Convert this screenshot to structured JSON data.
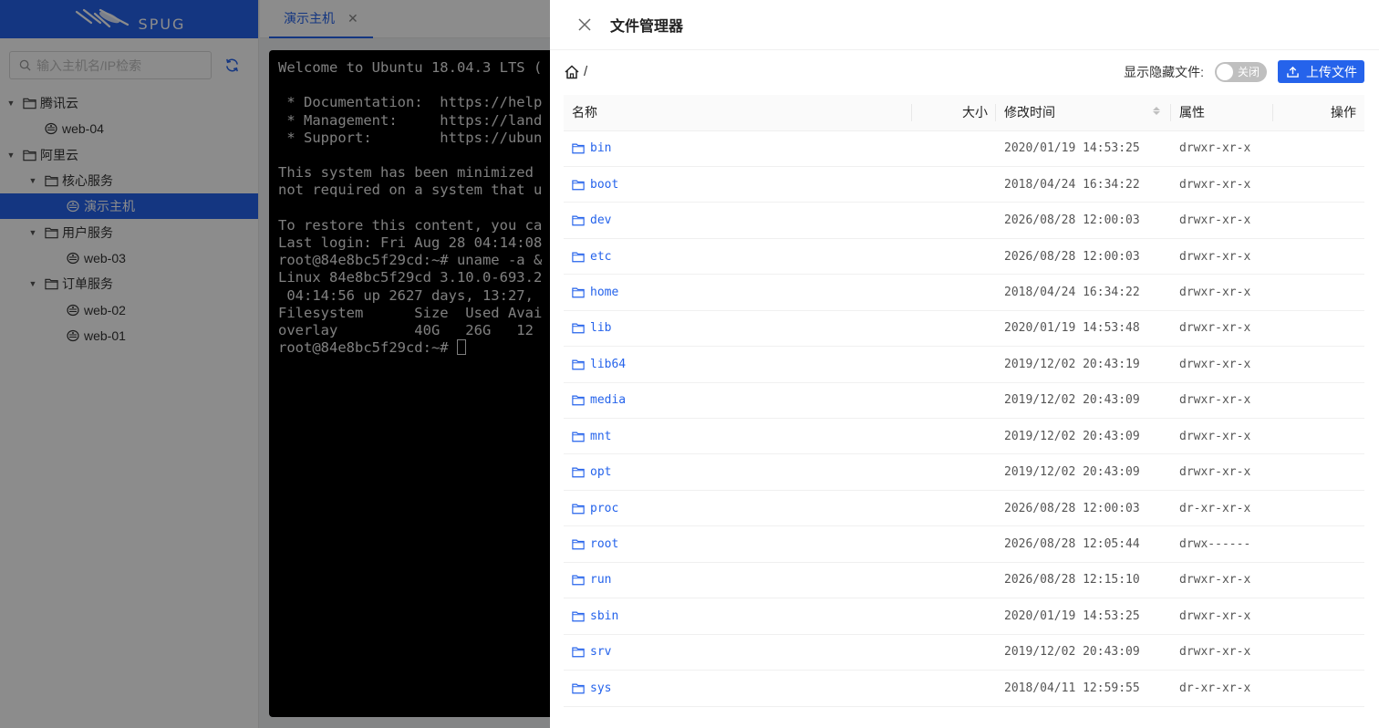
{
  "logo": {
    "text": "SPUG"
  },
  "sidebar": {
    "search_placeholder": "输入主机名/IP检索",
    "tree": [
      {
        "label": "腾讯云",
        "type": "group",
        "level": 0,
        "expanded": true
      },
      {
        "label": "web-04",
        "type": "host",
        "level": 1
      },
      {
        "label": "阿里云",
        "type": "group",
        "level": 0,
        "expanded": true
      },
      {
        "label": "核心服务",
        "type": "group",
        "level": 1,
        "expanded": true
      },
      {
        "label": "演示主机",
        "type": "host",
        "level": 2,
        "selected": true
      },
      {
        "label": "用户服务",
        "type": "group",
        "level": 1,
        "expanded": true
      },
      {
        "label": "web-03",
        "type": "host",
        "level": 2
      },
      {
        "label": "订单服务",
        "type": "group",
        "level": 1,
        "expanded": true
      },
      {
        "label": "web-02",
        "type": "host",
        "level": 2
      },
      {
        "label": "web-01",
        "type": "host",
        "level": 2
      }
    ]
  },
  "tabs": [
    {
      "label": "演示主机"
    }
  ],
  "terminal": {
    "lines": [
      "Welcome to Ubuntu 18.04.3 LTS (",
      "",
      " * Documentation:  https://help",
      " * Management:     https://land",
      " * Support:        https://ubun",
      "",
      "This system has been minimized",
      "not required on a system that u",
      "",
      "To restore this content, you ca",
      "Last login: Fri Aug 28 04:14:08",
      "root@84e8bc5f29cd:~# uname -a &",
      "Linux 84e8bc5f29cd 3.10.0-693.2",
      " 04:14:56 up 2627 days, 13:27,",
      "Filesystem      Size  Used Avai",
      "overlay         40G   26G   12",
      "root@84e8bc5f29cd:~# "
    ]
  },
  "drawer": {
    "title": "文件管理器",
    "path": "/",
    "show_hidden_label": "显示隐藏文件:",
    "switch_label": "关闭",
    "upload_label": "上传文件",
    "columns": {
      "name": "名称",
      "size": "大小",
      "mtime": "修改时间",
      "perm": "属性",
      "action": "操作"
    },
    "files": [
      {
        "name": "bin",
        "size": "",
        "mtime": "2020/01/19 14:53:25",
        "perm": "drwxr-xr-x"
      },
      {
        "name": "boot",
        "size": "",
        "mtime": "2018/04/24 16:34:22",
        "perm": "drwxr-xr-x"
      },
      {
        "name": "dev",
        "size": "",
        "mtime": "2026/08/28 12:00:03",
        "perm": "drwxr-xr-x"
      },
      {
        "name": "etc",
        "size": "",
        "mtime": "2026/08/28 12:00:03",
        "perm": "drwxr-xr-x"
      },
      {
        "name": "home",
        "size": "",
        "mtime": "2018/04/24 16:34:22",
        "perm": "drwxr-xr-x"
      },
      {
        "name": "lib",
        "size": "",
        "mtime": "2020/01/19 14:53:48",
        "perm": "drwxr-xr-x"
      },
      {
        "name": "lib64",
        "size": "",
        "mtime": "2019/12/02 20:43:19",
        "perm": "drwxr-xr-x"
      },
      {
        "name": "media",
        "size": "",
        "mtime": "2019/12/02 20:43:09",
        "perm": "drwxr-xr-x"
      },
      {
        "name": "mnt",
        "size": "",
        "mtime": "2019/12/02 20:43:09",
        "perm": "drwxr-xr-x"
      },
      {
        "name": "opt",
        "size": "",
        "mtime": "2019/12/02 20:43:09",
        "perm": "drwxr-xr-x"
      },
      {
        "name": "proc",
        "size": "",
        "mtime": "2026/08/28 12:00:03",
        "perm": "dr-xr-xr-x"
      },
      {
        "name": "root",
        "size": "",
        "mtime": "2026/08/28 12:05:44",
        "perm": "drwx------"
      },
      {
        "name": "run",
        "size": "",
        "mtime": "2026/08/28 12:15:10",
        "perm": "drwxr-xr-x"
      },
      {
        "name": "sbin",
        "size": "",
        "mtime": "2020/01/19 14:53:25",
        "perm": "drwxr-xr-x"
      },
      {
        "name": "srv",
        "size": "",
        "mtime": "2019/12/02 20:43:09",
        "perm": "drwxr-xr-x"
      },
      {
        "name": "sys",
        "size": "",
        "mtime": "2018/04/11 12:59:55",
        "perm": "dr-xr-xr-x"
      }
    ]
  },
  "colors": {
    "accent": "#2563eb",
    "terminal_bg": "#000000",
    "mask": "rgba(0,0,0,0.45)"
  }
}
